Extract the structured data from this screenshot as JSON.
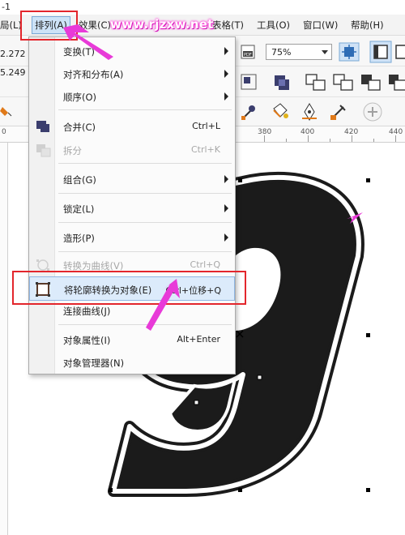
{
  "window": {
    "title_fragment": "-1"
  },
  "menubar": {
    "items": [
      {
        "id": "layout",
        "label": "局(L)"
      },
      {
        "id": "arrange",
        "label": "排列(A)"
      },
      {
        "id": "effects",
        "label": "效果(C)"
      },
      {
        "id": "table",
        "label": "表格(T)"
      },
      {
        "id": "tools",
        "label": "工具(O)"
      },
      {
        "id": "window",
        "label": "窗口(W)"
      },
      {
        "id": "help",
        "label": "帮助(H)"
      }
    ]
  },
  "watermark": "www.rjzxw.net",
  "toolbar": {
    "coord_x": "2.272 r",
    "coord_y": "5.249 r",
    "zoom": "75%"
  },
  "ruler": {
    "labels": [
      "0",
      "380",
      "400",
      "420",
      "440"
    ]
  },
  "dropdown": {
    "items": [
      {
        "label": "变换(T)",
        "shortcut": "",
        "submenu": true,
        "disabled": false
      },
      {
        "label": "对齐和分布(A)",
        "shortcut": "",
        "submenu": true,
        "disabled": false
      },
      {
        "label": "顺序(O)",
        "shortcut": "",
        "submenu": true,
        "disabled": false
      },
      {
        "label": "合并(C)",
        "shortcut": "Ctrl+L",
        "submenu": false,
        "disabled": false
      },
      {
        "label": "拆分",
        "shortcut": "Ctrl+K",
        "submenu": false,
        "disabled": true
      },
      {
        "label": "组合(G)",
        "shortcut": "",
        "submenu": true,
        "disabled": false
      },
      {
        "label": "锁定(L)",
        "shortcut": "",
        "submenu": true,
        "disabled": false
      },
      {
        "label": "造形(P)",
        "shortcut": "",
        "submenu": true,
        "disabled": false
      },
      {
        "label": "转换为曲线(V)",
        "shortcut": "Ctrl+Q",
        "submenu": false,
        "disabled": true
      },
      {
        "label": "将轮廓转换为对象(E)",
        "shortcut": "Ctrl+位移+Q",
        "submenu": false,
        "disabled": false,
        "highlighted": true
      },
      {
        "label": "连接曲线(J)",
        "shortcut": "",
        "submenu": false,
        "disabled": false
      },
      {
        "label": "对象属性(I)",
        "shortcut": "Alt+Enter",
        "submenu": false,
        "disabled": false
      },
      {
        "label": "对象管理器(N)",
        "shortcut": "",
        "submenu": false,
        "disabled": false
      }
    ]
  },
  "canvas": {
    "glyph": "9"
  },
  "colors": {
    "highlight_box": "#e3262c",
    "annotation_arrow": "#e83ad8",
    "menu_hover": "#dcebfb"
  }
}
